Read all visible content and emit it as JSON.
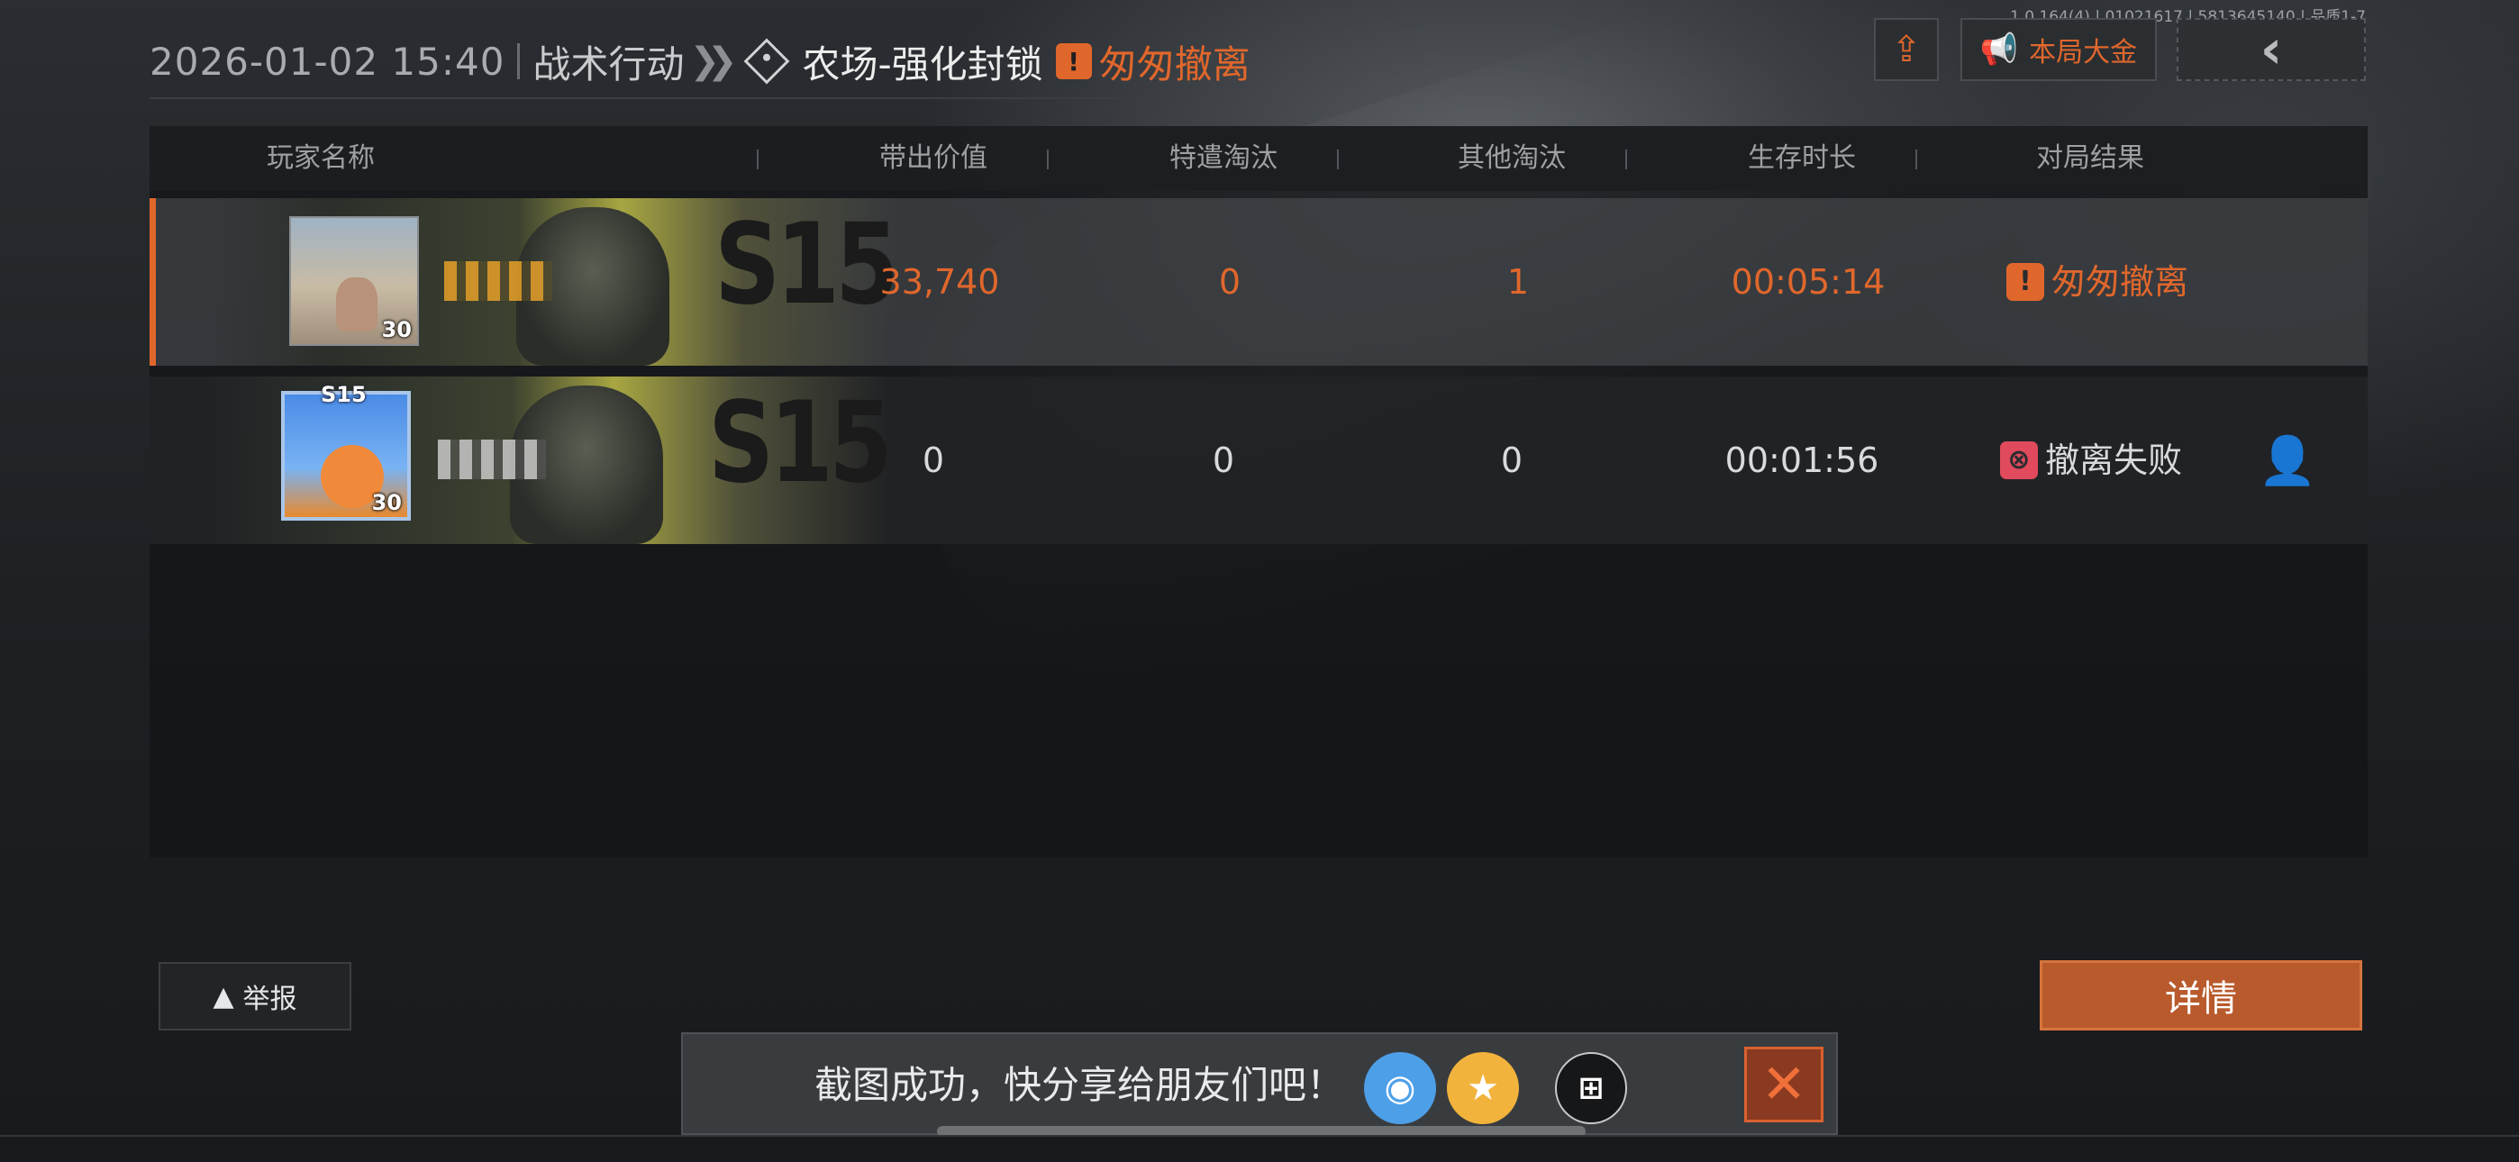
{
  "version_text": "1.0.164(4) | 01021617 | 5813645140 | 品质1-7",
  "header": {
    "datetime": "2026-01-02 15:40",
    "mode": "战术行动",
    "map": "农场-强化封锁",
    "status_icon": "warning-triangle-icon",
    "status": "匆匆撤离"
  },
  "top_buttons": {
    "share_icon": "share-icon",
    "all_label": "本局大金",
    "all_icon": "megaphone-icon",
    "back_icon": "chevron-left-icon"
  },
  "table": {
    "headers": [
      "玩家名称",
      "带出价值",
      "特遣淘汰",
      "其他淘汰",
      "生存时长",
      "对局结果"
    ],
    "rows": [
      {
        "level": "30",
        "value": "33,740",
        "special_kills": "0",
        "other_kills": "1",
        "survival": "00:05:14",
        "result": "匆匆撤离",
        "result_type": "escape",
        "highlighted": true
      },
      {
        "level": "30",
        "season_badge": "S15",
        "value": "0",
        "special_kills": "0",
        "other_kills": "0",
        "survival": "00:01:56",
        "result": "撤离失败",
        "result_type": "fail",
        "highlighted": false
      }
    ],
    "banner_text": "S15"
  },
  "buttons": {
    "report_label": "举报",
    "detail_label": "详情"
  },
  "toast": {
    "text": "截图成功，快分享给朋友们吧！",
    "icons": [
      "qq-icon",
      "qzone-icon",
      "share-app-icon"
    ],
    "close_icon": "close-icon"
  },
  "colors": {
    "accent": "#e0672c",
    "fail": "#e04a5c",
    "detail_button": "#b85a2c"
  }
}
